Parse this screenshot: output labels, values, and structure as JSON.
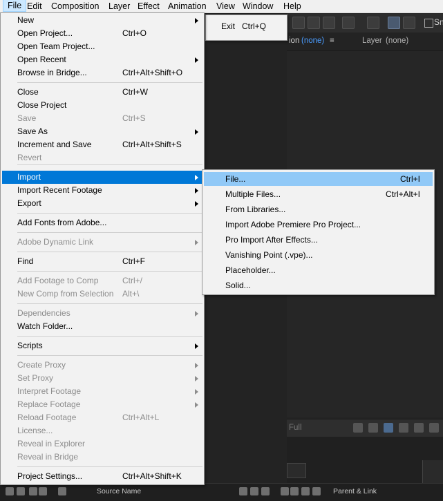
{
  "menubar": [
    "File",
    "Edit",
    "Composition",
    "Layer",
    "Effect",
    "Animation",
    "View",
    "Window",
    "Help"
  ],
  "exit_menu": {
    "label": "Exit",
    "shortcut": "Ctrl+Q"
  },
  "panel": {
    "tab_comp_suffix": "ion",
    "tab_comp_value": "(none)",
    "menu_glyph": "≡",
    "tab_layer": "Layer",
    "tab_layer_value": "(none)",
    "checkbox_label": "Sn",
    "dropdown_value": "Full"
  },
  "file_menu": [
    {
      "label": "New",
      "shortcut": "",
      "submenu": true,
      "disabled": false
    },
    {
      "label": "Open Project...",
      "shortcut": "Ctrl+O",
      "submenu": false,
      "disabled": false
    },
    {
      "label": "Open Team Project...",
      "shortcut": "",
      "submenu": false,
      "disabled": false
    },
    {
      "label": "Open Recent",
      "shortcut": "",
      "submenu": true,
      "disabled": false
    },
    {
      "label": "Browse in Bridge...",
      "shortcut": "Ctrl+Alt+Shift+O",
      "submenu": false,
      "disabled": false
    },
    {
      "label": "Close",
      "shortcut": "Ctrl+W",
      "submenu": false,
      "disabled": false
    },
    {
      "label": "Close Project",
      "shortcut": "",
      "submenu": false,
      "disabled": false
    },
    {
      "label": "Save",
      "shortcut": "Ctrl+S",
      "submenu": false,
      "disabled": true
    },
    {
      "label": "Save As",
      "shortcut": "",
      "submenu": true,
      "disabled": false
    },
    {
      "label": "Increment and Save",
      "shortcut": "Ctrl+Alt+Shift+S",
      "submenu": false,
      "disabled": false
    },
    {
      "label": "Revert",
      "shortcut": "",
      "submenu": false,
      "disabled": true
    },
    {
      "label": "Import",
      "shortcut": "",
      "submenu": true,
      "disabled": false,
      "active": true
    },
    {
      "label": "Import Recent Footage",
      "shortcut": "",
      "submenu": true,
      "disabled": false
    },
    {
      "label": "Export",
      "shortcut": "",
      "submenu": true,
      "disabled": false
    },
    {
      "label": "Add Fonts from Adobe...",
      "shortcut": "",
      "submenu": false,
      "disabled": false
    },
    {
      "label": "Adobe Dynamic Link",
      "shortcut": "",
      "submenu": true,
      "disabled": true
    },
    {
      "label": "Find",
      "shortcut": "Ctrl+F",
      "submenu": false,
      "disabled": false
    },
    {
      "label": "Add Footage to Comp",
      "shortcut": "Ctrl+/",
      "submenu": false,
      "disabled": true
    },
    {
      "label": "New Comp from Selection",
      "shortcut": "Alt+\\",
      "submenu": false,
      "disabled": true
    },
    {
      "label": "Dependencies",
      "shortcut": "",
      "submenu": true,
      "disabled": true
    },
    {
      "label": "Watch Folder...",
      "shortcut": "",
      "submenu": false,
      "disabled": false
    },
    {
      "label": "Scripts",
      "shortcut": "",
      "submenu": true,
      "disabled": false
    },
    {
      "label": "Create Proxy",
      "shortcut": "",
      "submenu": true,
      "disabled": true
    },
    {
      "label": "Set Proxy",
      "shortcut": "",
      "submenu": true,
      "disabled": true
    },
    {
      "label": "Interpret Footage",
      "shortcut": "",
      "submenu": true,
      "disabled": true
    },
    {
      "label": "Replace Footage",
      "shortcut": "",
      "submenu": true,
      "disabled": true
    },
    {
      "label": "Reload Footage",
      "shortcut": "Ctrl+Alt+L",
      "submenu": false,
      "disabled": true
    },
    {
      "label": "License...",
      "shortcut": "",
      "submenu": false,
      "disabled": true
    },
    {
      "label": "Reveal in Explorer",
      "shortcut": "",
      "submenu": false,
      "disabled": true
    },
    {
      "label": "Reveal in Bridge",
      "shortcut": "",
      "submenu": false,
      "disabled": true
    },
    {
      "label": "Project Settings...",
      "shortcut": "Ctrl+Alt+Shift+K",
      "submenu": false,
      "disabled": false
    }
  ],
  "import_menu": [
    {
      "label": "File...",
      "shortcut": "Ctrl+I",
      "highlighted": true
    },
    {
      "label": "Multiple Files...",
      "shortcut": "Ctrl+Alt+I"
    },
    {
      "label": "From Libraries...",
      "shortcut": ""
    },
    {
      "label": "Import Adobe Premiere Pro Project...",
      "shortcut": ""
    },
    {
      "label": "Pro Import After Effects...",
      "shortcut": ""
    },
    {
      "label": "Vanishing Point (.vpe)...",
      "shortcut": ""
    },
    {
      "label": "Placeholder...",
      "shortcut": ""
    },
    {
      "label": "Solid...",
      "shortcut": ""
    }
  ],
  "timeline": {
    "source_name": "Source Name",
    "parent_link": "Parent & Link"
  }
}
